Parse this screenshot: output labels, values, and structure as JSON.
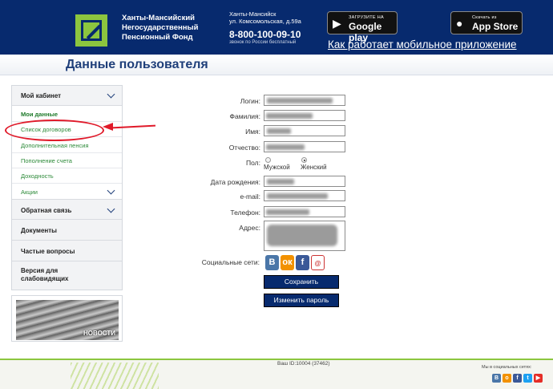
{
  "header": {
    "org_name": "Ханты-Мансийский Негосударственный Пенсионный Фонд",
    "address_city": "Ханты-Мансийск",
    "address_street": "ул. Комсомольская, д.59а",
    "phone": "8-800-100-09-10",
    "phone_note": "звонок по России бесплатный",
    "google_play_small": "ЗАГРУЗИТЕ НА",
    "google_play_big": "Google play",
    "app_store_small": "Скачать из",
    "app_store_big": "App Store",
    "mobile_link": "Как работает мобильное приложение"
  },
  "page_title": "Данные пользователя",
  "sidebar": {
    "cabinet": "Мой кабинет",
    "items": [
      "Мои данные",
      "Список договоров",
      "Дополнительная пенсия",
      "Пополнение счета",
      "Доходность",
      "Акции"
    ],
    "feedback": "Обратная связь",
    "documents": "Документы",
    "faq": "Частые вопросы",
    "accessible": "Версия для слабовидящих",
    "news": "НОВОСТИ"
  },
  "form": {
    "login_label": "Логин:",
    "surname_label": "Фамилия:",
    "name_label": "Имя:",
    "patronymic_label": "Отчество:",
    "gender_label": "Пол:",
    "male": "Мужской",
    "female": "Женский",
    "birthdate_label": "Дата рождения:",
    "email_label": "e-mail:",
    "phone_label": "Телефон:",
    "address_label": "Адрес:",
    "social_label": "Социальные сети:",
    "save_button": "Сохранить",
    "change_password_button": "Изменить пароль"
  },
  "social_icons": [
    "vk-icon",
    "odnoklassniki-icon",
    "facebook-icon",
    "mail-icon"
  ],
  "footer": {
    "user_id": "Ваш ID:10004 (37462)",
    "social_text": "Мы в социальных сетях:",
    "icons": [
      "vk-icon",
      "odnoklassniki-icon",
      "facebook-icon",
      "twitter-icon",
      "youtube-icon"
    ]
  },
  "colors": {
    "header_bg": "#072a6e",
    "accent_green": "#8cc63f",
    "title_blue": "#1f3f7a",
    "link_green": "#2e8b3a",
    "annotation_red": "#e01a2a"
  }
}
